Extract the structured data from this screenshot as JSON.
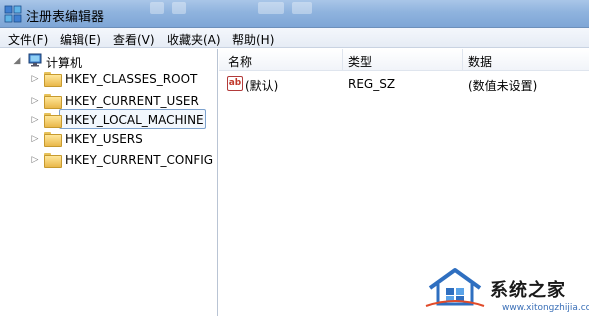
{
  "window": {
    "title": "注册表编辑器"
  },
  "menu": [
    {
      "label": "文件(F)"
    },
    {
      "label": "编辑(E)"
    },
    {
      "label": "查看(V)"
    },
    {
      "label": "收藏夹(A)"
    },
    {
      "label": "帮助(H)"
    }
  ],
  "tree": {
    "root_label": "计算机",
    "items": [
      {
        "label": "HKEY_CLASSES_ROOT",
        "selected": false
      },
      {
        "label": "HKEY_CURRENT_USER",
        "selected": false
      },
      {
        "label": "HKEY_LOCAL_MACHINE",
        "selected": true
      },
      {
        "label": "HKEY_USERS",
        "selected": false
      },
      {
        "label": "HKEY_CURRENT_CONFIG",
        "selected": false
      }
    ]
  },
  "list": {
    "columns": [
      "名称",
      "类型",
      "数据"
    ],
    "rows": [
      {
        "icon": "ab",
        "name": "(默认)",
        "type": "REG_SZ",
        "data": "(数值未设置)"
      }
    ]
  },
  "watermark": {
    "text": "系统之家",
    "url": "www.xitongzhijia.com"
  },
  "colors": {
    "title_bar": "#8fb3de",
    "menu_bar": "#eaf0f8",
    "selection_border": "#7da2ce",
    "folder": "#e9b84a",
    "watermark_blue": "#2f6fc0"
  },
  "icons": {
    "app": "registry-editor-icon",
    "computer": "computer-icon",
    "folder": "folder-icon",
    "expander": "triangle-right-icon",
    "string_value": "ab-string-value-icon"
  }
}
